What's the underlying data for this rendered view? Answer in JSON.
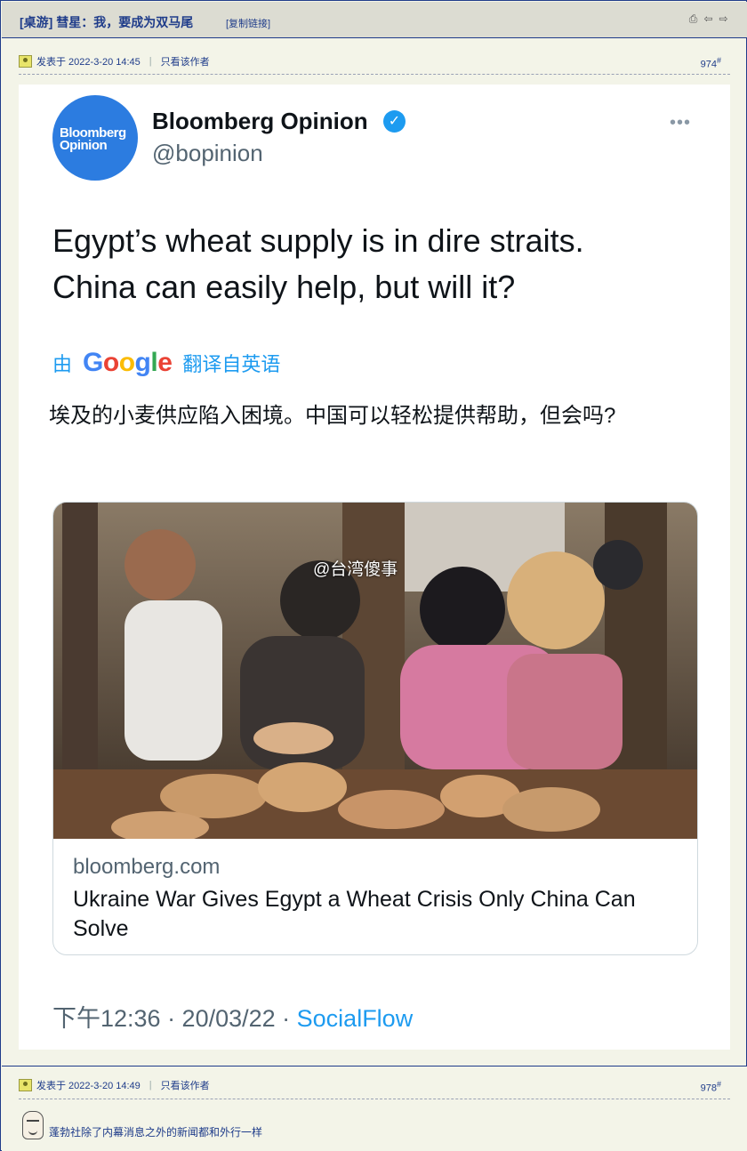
{
  "header": {
    "title": "[桌游] 彗星：我，要成为双马尾",
    "copy_link": "[复制链接]",
    "tools": [
      "print-icon",
      "prev-icon",
      "next-icon"
    ]
  },
  "post1": {
    "posted": "发表于 2022-3-20 14:45",
    "only_author": "只看该作者",
    "floor": "974",
    "floor_mark": "#"
  },
  "tweet": {
    "avatar_line1": "Bloomberg",
    "avatar_line2": "Opinion",
    "name": "Bloomberg Opinion",
    "verified_mark": "✓",
    "handle": "@bopinion",
    "more": "•••",
    "text_en": "Egypt’s wheat supply is in dire straits. China can easily help, but will it?",
    "translate_prefix": "由",
    "translate_brand": "Google",
    "translate_suffix": "翻译自英语",
    "text_zh": "埃及的小麦供应陷入困境。中国可以轻松提供帮助，但会吗?",
    "card": {
      "watermark": "@台湾傻事",
      "domain": "bloomberg.com",
      "headline": "Ukraine War Gives Egypt a Wheat Crisis Only China Can Solve"
    },
    "time": "下午12:36 · 20/03/22 · ",
    "source": "SocialFlow"
  },
  "post2": {
    "posted": "发表于 2022-3-20 14:49",
    "only_author": "只看该作者",
    "floor": "978",
    "floor_mark": "#",
    "reply": "蓬勃社除了内幕消息之外的新闻都和外行一样"
  },
  "colors": {
    "link_blue": "#1d9bf0",
    "forum_blue": "#1f3c8a",
    "avatar_blue": "#2c7ce0"
  }
}
